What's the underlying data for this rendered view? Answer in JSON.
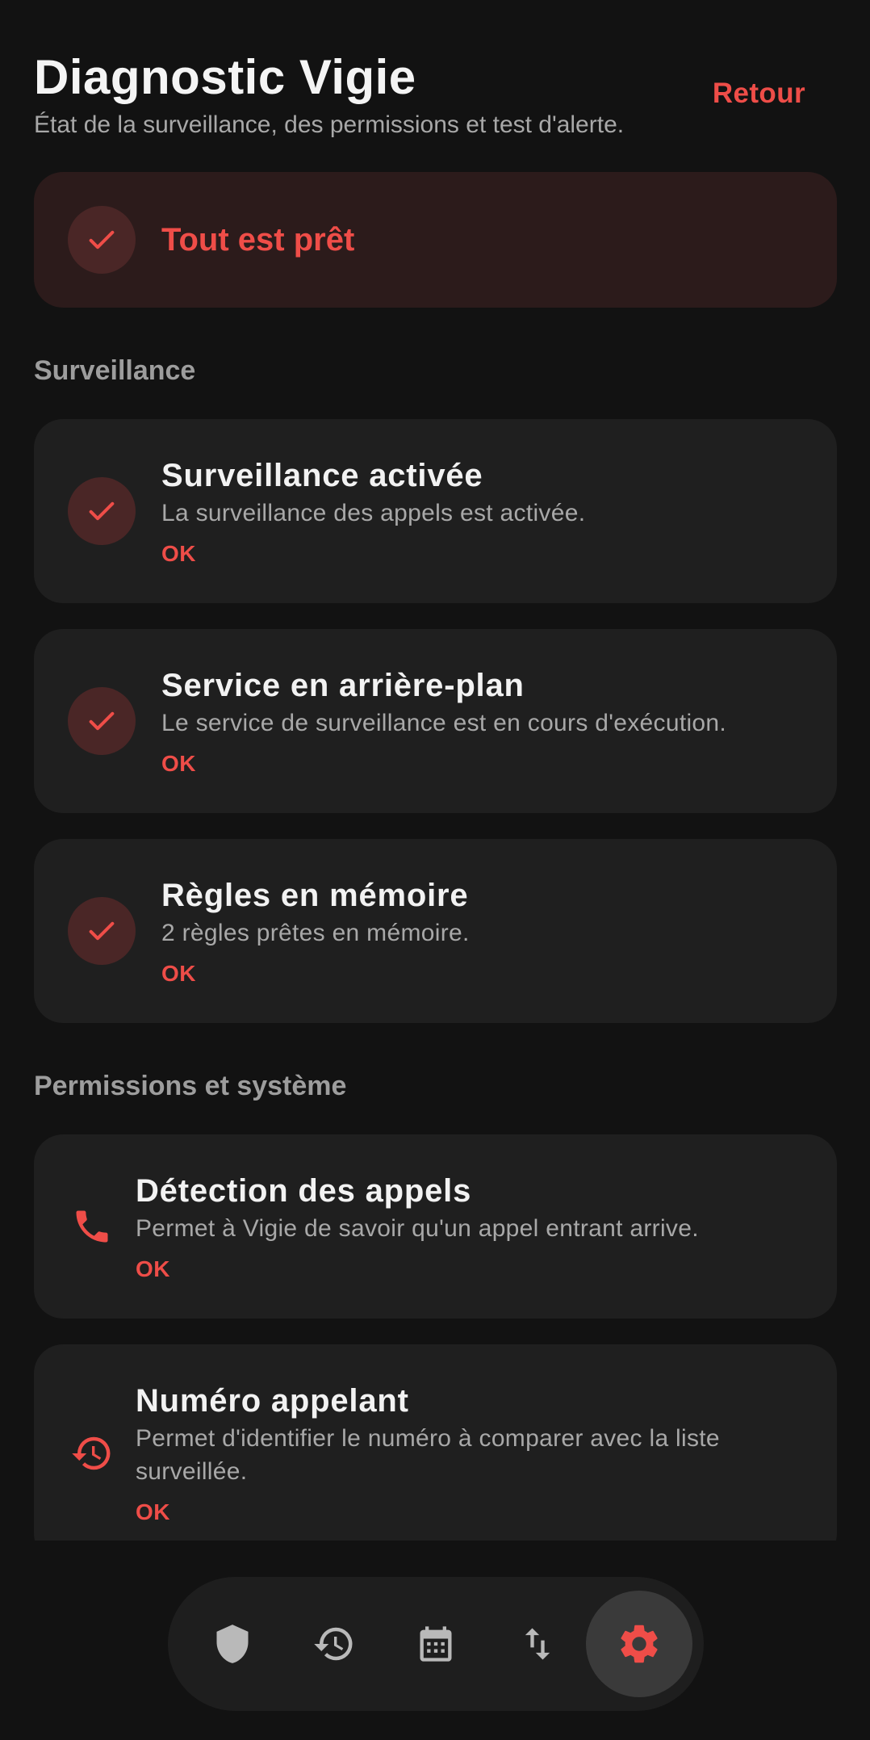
{
  "header": {
    "title": "Diagnostic Vigie",
    "subtitle": "État de la surveillance, des permissions et test d'alerte.",
    "back_label": "Retour"
  },
  "banner": {
    "icon": "check-icon",
    "text": "Tout est prêt"
  },
  "sections": {
    "monitoring_label": "Surveillance",
    "permissions_label": "Permissions et système"
  },
  "monitoring": [
    {
      "icon": "check-icon",
      "title": "Surveillance activée",
      "description": "La surveillance des appels est activée.",
      "status": "OK"
    },
    {
      "icon": "check-icon",
      "title": "Service en arrière-plan",
      "description": "Le service de surveillance est en cours d'exécution.",
      "status": "OK"
    },
    {
      "icon": "check-icon",
      "title": "Règles en mémoire",
      "description": "2 règles prêtes en mémoire.",
      "status": "OK"
    }
  ],
  "permissions": [
    {
      "icon": "phone-icon",
      "title": "Détection des appels",
      "description": "Permet à Vigie de savoir qu'un appel entrant arrive.",
      "status": "OK"
    },
    {
      "icon": "history-icon",
      "title": "Numéro appelant",
      "description_line1": "Permet d'identifier le numéro à comparer avec la liste",
      "description_line2": "surveillée.",
      "status": "OK"
    }
  ],
  "nav": {
    "items": [
      "shield-icon",
      "history-icon",
      "calendar-icon",
      "swap-vertical-icon",
      "settings-icon"
    ],
    "active": "settings-icon"
  },
  "colors": {
    "accent": "#EE4D48",
    "background": "#121212",
    "card": "#1F1F1F",
    "banner": "#2C1B1B"
  }
}
